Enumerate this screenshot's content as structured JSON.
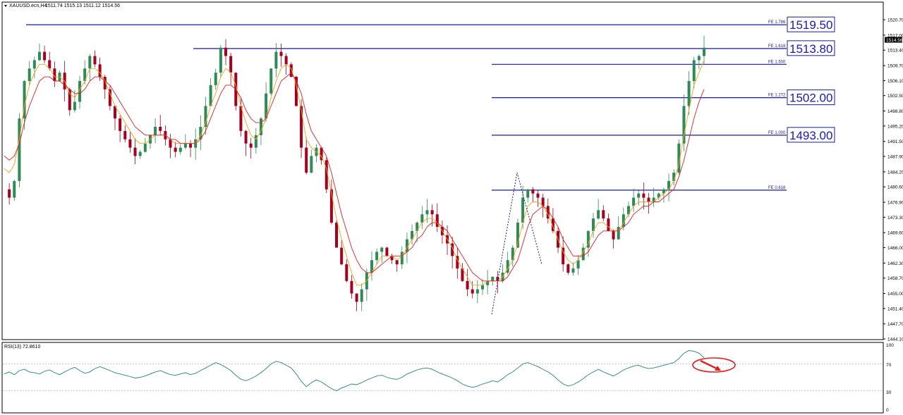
{
  "header": {
    "symbol": "XAUUSD.ecn,H4",
    "quote": "1511.74 1515.13 1511.12 1514.56",
    "last_price": "1514.56"
  },
  "rsi": {
    "label": "RSI(13) 72.8610",
    "ticks": [
      "100",
      "70",
      "30",
      "0"
    ]
  },
  "colors": {
    "bull_candle": "#2e8b57",
    "bear_candle": "#a5001e",
    "fast_ma": "#f5a31a",
    "slow_ma": "#e02020",
    "fib_line": "#1a1aa0",
    "rsi_line": "#2a7f7f",
    "arrow": "#e02020"
  },
  "chart_data": {
    "type": "candlestick",
    "symbol": "XAUUSD.ecn",
    "timeframe": "H4",
    "ylim": [
      1444.1,
      1522.4
    ],
    "y_ticks": [
      "1520.70",
      "1517.00",
      "1513.40",
      "1509.70",
      "1506.10",
      "1502.50",
      "1498.80",
      "1495.20",
      "1491.50",
      "1487.90",
      "1484.20",
      "1480.60",
      "1476.90",
      "1473.30",
      "1469.60",
      "1466.00",
      "1462.30",
      "1458.70",
      "1455.00",
      "1451.40",
      "1447.70",
      "1444.10"
    ],
    "fib_levels": [
      {
        "label": "FE 1.786",
        "price": 1519.5,
        "price_label": "1519.50"
      },
      {
        "label": "FE 1.618",
        "price": 1513.8,
        "price_label": "1513.80"
      },
      {
        "label": "FE 1.500",
        "price": 1510.0
      },
      {
        "label": "FE 1.272",
        "price": 1502.0,
        "price_label": "1502.00"
      },
      {
        "label": "FE 1.000",
        "price": 1493.0,
        "price_label": "1493.00"
      },
      {
        "label": "FE 0.618",
        "price": 1479.8
      }
    ],
    "price_path": [
      1480,
      1478,
      1482,
      1497,
      1506,
      1509,
      1511,
      1513,
      1511,
      1509,
      1506,
      1508,
      1504,
      1499,
      1501,
      1506,
      1509,
      1512,
      1510,
      1507,
      1504,
      1500,
      1497,
      1494,
      1492,
      1490,
      1488,
      1489,
      1491,
      1493,
      1495,
      1494,
      1492,
      1490,
      1489,
      1490,
      1491,
      1490,
      1492,
      1495,
      1500,
      1505,
      1508,
      1514,
      1512,
      1508,
      1500,
      1494,
      1491,
      1490,
      1493,
      1497,
      1503,
      1509,
      1513,
      1512,
      1510,
      1507,
      1500,
      1490,
      1484,
      1488,
      1490,
      1487,
      1480,
      1472,
      1466,
      1462,
      1458,
      1455,
      1453,
      1456,
      1460,
      1463,
      1465,
      1466,
      1464,
      1463,
      1462,
      1465,
      1468,
      1470,
      1472,
      1474,
      1475,
      1474,
      1471,
      1469,
      1467,
      1464,
      1461,
      1458,
      1456,
      1455,
      1456,
      1457,
      1458,
      1459,
      1458,
      1460,
      1463,
      1466,
      1472,
      1478,
      1480,
      1479,
      1478,
      1476,
      1473,
      1470,
      1466,
      1462,
      1460,
      1461,
      1463,
      1466,
      1470,
      1473,
      1475,
      1473,
      1470,
      1468,
      1471,
      1474,
      1476,
      1478,
      1479,
      1478,
      1477,
      1478,
      1479,
      1480,
      1482,
      1484,
      1491,
      1500,
      1506,
      1511,
      1512,
      1514
    ],
    "fast_ma_path": [
      1485,
      1484,
      1486,
      1492,
      1500,
      1505,
      1508,
      1510,
      1510,
      1509,
      1507,
      1507,
      1506,
      1503,
      1502,
      1504,
      1506,
      1509,
      1509,
      1508,
      1506,
      1503,
      1500,
      1498,
      1496,
      1494,
      1492,
      1491,
      1491,
      1492,
      1493,
      1493,
      1493,
      1492,
      1491,
      1491,
      1491,
      1491,
      1491,
      1493,
      1496,
      1500,
      1503,
      1507,
      1509,
      1508,
      1505,
      1500,
      1496,
      1493,
      1492,
      1494,
      1497,
      1502,
      1506,
      1509,
      1510,
      1509,
      1505,
      1499,
      1492,
      1490,
      1489,
      1488,
      1485,
      1479,
      1473,
      1468,
      1464,
      1460,
      1457,
      1457,
      1458,
      1460,
      1462,
      1464,
      1464,
      1464,
      1463,
      1464,
      1466,
      1468,
      1470,
      1472,
      1473,
      1473,
      1472,
      1470,
      1468,
      1466,
      1463,
      1461,
      1459,
      1457,
      1457,
      1457,
      1458,
      1458,
      1458,
      1459,
      1461,
      1463,
      1467,
      1472,
      1476,
      1477,
      1477,
      1476,
      1474,
      1471,
      1468,
      1465,
      1463,
      1462,
      1463,
      1465,
      1467,
      1470,
      1472,
      1472,
      1471,
      1470,
      1470,
      1472,
      1474,
      1476,
      1477,
      1477,
      1477,
      1477,
      1478,
      1479,
      1480,
      1482,
      1486,
      1493,
      1499,
      1505,
      1508,
      1511
    ],
    "slow_ma_path": [
      1488,
      1487,
      1488,
      1491,
      1496,
      1500,
      1503,
      1506,
      1507,
      1507,
      1506,
      1506,
      1505,
      1504,
      1503,
      1503,
      1504,
      1506,
      1507,
      1507,
      1506,
      1505,
      1503,
      1501,
      1499,
      1497,
      1495,
      1494,
      1493,
      1493,
      1493,
      1493,
      1493,
      1492,
      1492,
      1491,
      1491,
      1491,
      1491,
      1492,
      1494,
      1497,
      1500,
      1503,
      1505,
      1505,
      1504,
      1502,
      1499,
      1497,
      1496,
      1496,
      1497,
      1500,
      1503,
      1506,
      1507,
      1508,
      1506,
      1503,
      1498,
      1494,
      1492,
      1490,
      1488,
      1484,
      1479,
      1474,
      1470,
      1466,
      1463,
      1461,
      1460,
      1460,
      1461,
      1462,
      1463,
      1464,
      1464,
      1464,
      1465,
      1466,
      1468,
      1469,
      1471,
      1472,
      1472,
      1471,
      1470,
      1468,
      1466,
      1464,
      1462,
      1460,
      1459,
      1458,
      1458,
      1458,
      1458,
      1458,
      1459,
      1461,
      1463,
      1467,
      1471,
      1474,
      1475,
      1476,
      1475,
      1473,
      1471,
      1468,
      1466,
      1464,
      1464,
      1464,
      1465,
      1467,
      1469,
      1470,
      1470,
      1470,
      1470,
      1471,
      1472,
      1474,
      1475,
      1476,
      1476,
      1477,
      1477,
      1478,
      1479,
      1480,
      1483,
      1487,
      1492,
      1497,
      1501,
      1504
    ],
    "rsi_values": [
      55,
      58,
      54,
      60,
      62,
      58,
      57,
      55,
      59,
      61,
      57,
      54,
      58,
      62,
      65,
      60,
      56,
      58,
      63,
      66,
      63,
      60,
      57,
      55,
      53,
      51,
      49,
      50,
      52,
      55,
      58,
      60,
      57,
      54,
      53,
      55,
      57,
      54,
      56,
      60,
      64,
      68,
      72,
      69,
      65,
      60,
      53,
      47,
      45,
      48,
      52,
      57,
      63,
      70,
      74,
      72,
      68,
      64,
      55,
      44,
      36,
      42,
      46,
      43,
      38,
      33,
      30,
      34,
      37,
      40,
      39,
      42,
      46,
      49,
      52,
      53,
      50,
      48,
      47,
      50,
      55,
      58,
      61,
      63,
      64,
      62,
      58,
      55,
      52,
      49,
      45,
      40,
      37,
      35,
      37,
      40,
      42,
      45,
      43,
      48,
      54,
      58,
      64,
      70,
      72,
      69,
      66,
      62,
      58,
      53,
      46,
      40,
      37,
      39,
      43,
      48,
      54,
      58,
      62,
      58,
      55,
      52,
      56,
      61,
      64,
      67,
      68,
      65,
      63,
      64,
      66,
      68,
      70,
      72,
      78,
      86,
      90,
      89,
      86,
      79
    ]
  }
}
